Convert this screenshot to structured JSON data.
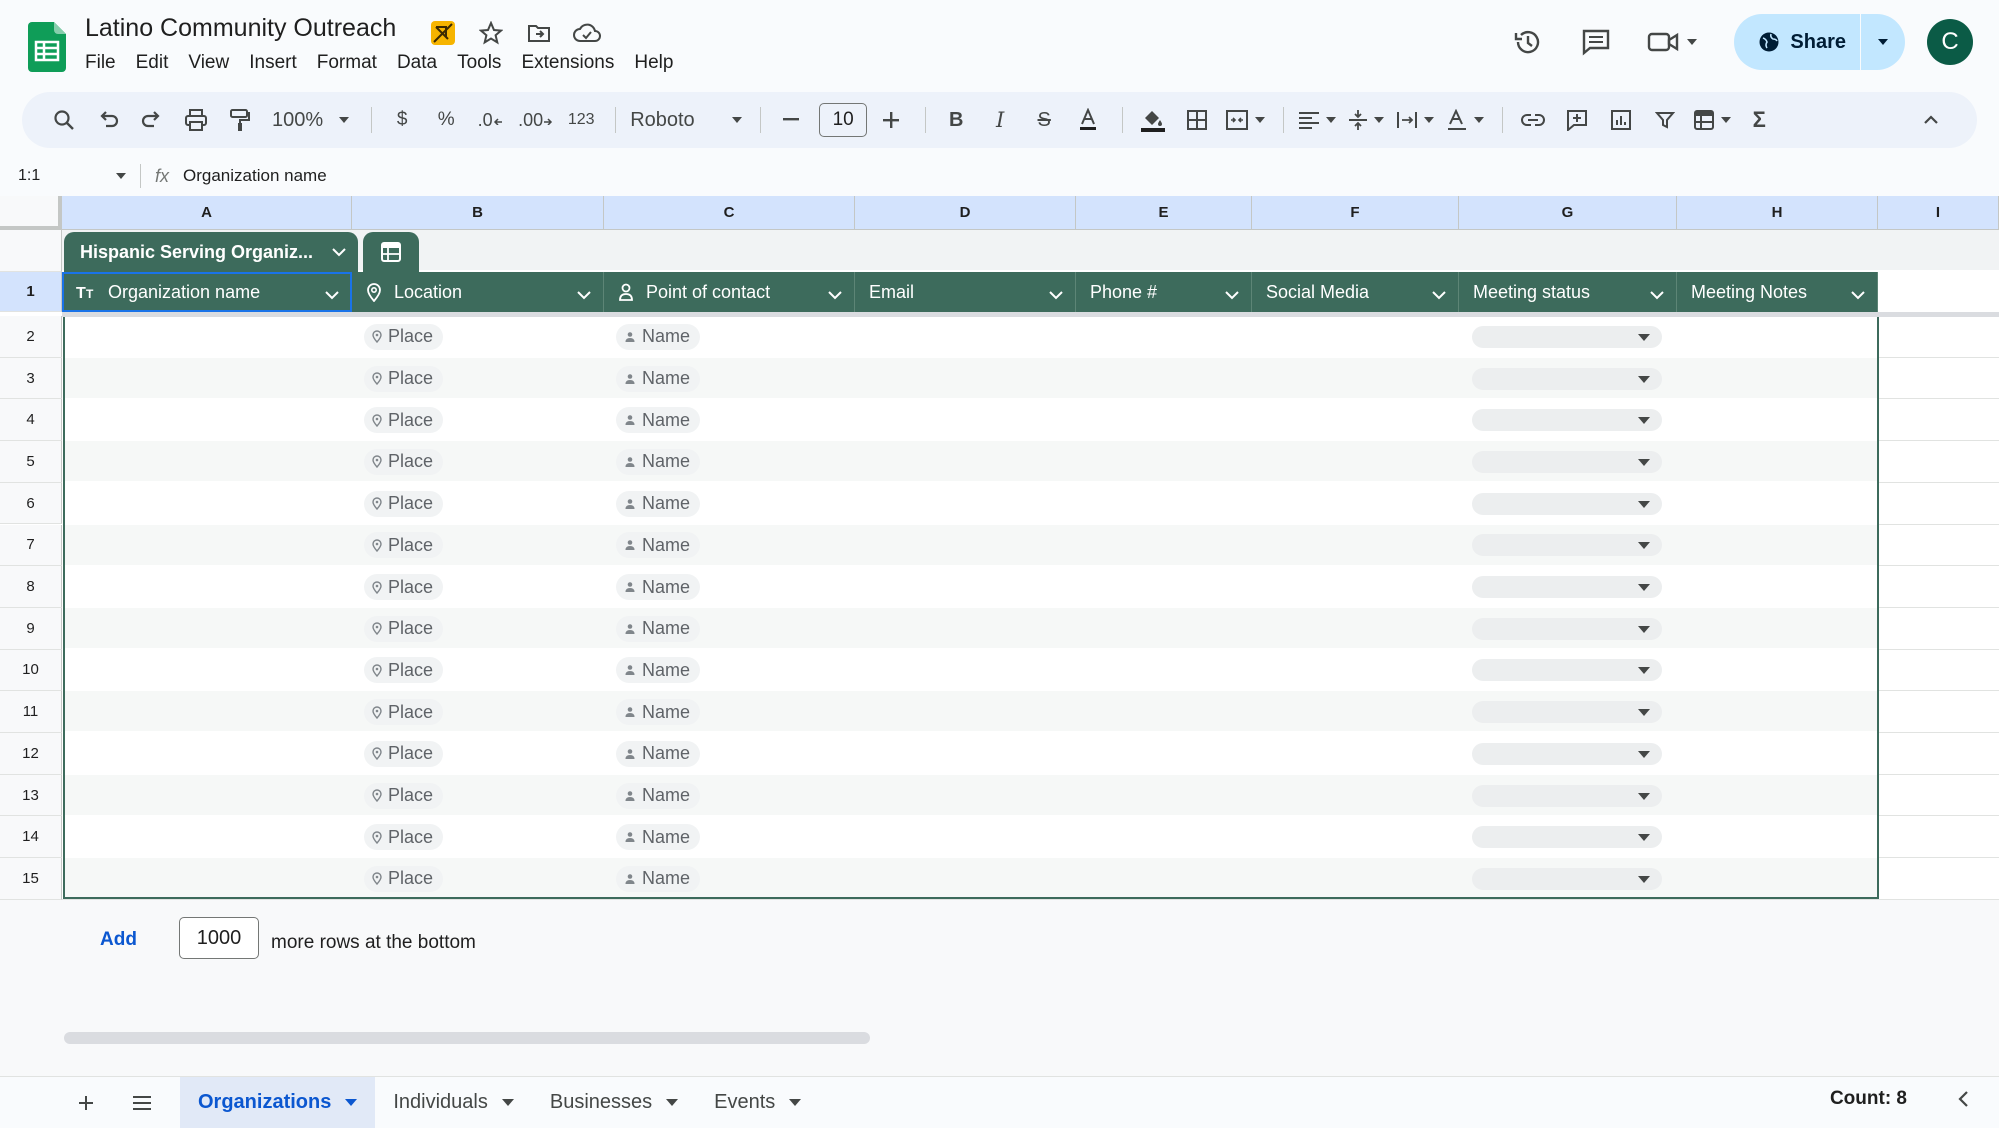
{
  "doc": {
    "title": "Latino Community Outreach"
  },
  "menu": [
    "File",
    "Edit",
    "View",
    "Insert",
    "Format",
    "Data",
    "Tools",
    "Extensions",
    "Help"
  ],
  "header_right": {
    "share_label": "Share",
    "avatar_letter": "C"
  },
  "toolbar": {
    "zoom": "100%",
    "currency": "$",
    "percent": "%",
    "dec_decrease": ".0",
    "dec_increase": ".00",
    "number_format": "123",
    "font": "Roboto",
    "font_size": "10"
  },
  "formula_bar": {
    "name_box": "1:1",
    "fx": "fx",
    "value": "Organization name"
  },
  "columns": [
    "A",
    "B",
    "C",
    "D",
    "E",
    "F",
    "G",
    "H",
    "I"
  ],
  "table": {
    "name": "Hispanic Serving Organiz...",
    "headers": [
      "Organization name",
      "Location",
      "Point of contact",
      "Email",
      "Phone #",
      "Social Media",
      "Meeting status",
      "Meeting Notes"
    ],
    "row_numbers": [
      "1",
      "2",
      "3",
      "4",
      "5",
      "6",
      "7",
      "8",
      "9",
      "10",
      "11",
      "12",
      "13",
      "14",
      "15"
    ],
    "location_placeholder": "Place",
    "contact_placeholder": "Name"
  },
  "add_rows": {
    "link": "Add",
    "count": "1000",
    "text": "more rows at the bottom"
  },
  "sheets": [
    {
      "label": "Organizations",
      "active": true
    },
    {
      "label": "Individuals",
      "active": false
    },
    {
      "label": "Businesses",
      "active": false
    },
    {
      "label": "Events",
      "active": false
    }
  ],
  "status": {
    "count": "Count: 8"
  },
  "colors": {
    "table_header": "#3d6b5c",
    "accent": "#0b57d0",
    "share_bg": "#c2e7ff"
  }
}
